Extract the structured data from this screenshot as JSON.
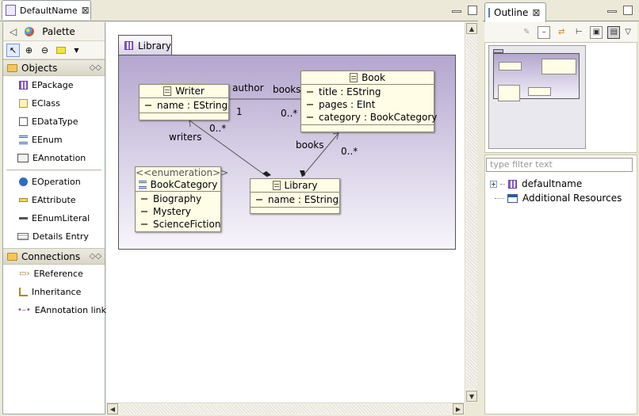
{
  "editor": {
    "tab_title": "DefaultName",
    "close_glyph": "⊠"
  },
  "palette": {
    "title": "Palette",
    "objects_drawer": "Objects",
    "objects": [
      "EPackage",
      "EClass",
      "EDataType",
      "EEnum",
      "EAnnotation"
    ],
    "features": [
      "EOperation",
      "EAttribute",
      "EEnumLiteral",
      "Details Entry"
    ],
    "connections_drawer": "Connections",
    "connections": [
      "EReference",
      "Inheritance",
      "EAnnotation link"
    ],
    "tools": [
      "select-tool",
      "zoom-in-tool",
      "zoom-out-tool",
      "note-tool"
    ]
  },
  "diagram": {
    "package_name": "Library",
    "writer": {
      "name": "Writer",
      "attr": "name : EString"
    },
    "book": {
      "name": "Book",
      "attrs": [
        "title : EString",
        "pages : EInt",
        "category : BookCategory"
      ]
    },
    "library": {
      "name": "Library",
      "attr": "name : EString"
    },
    "enum": {
      "stereotype": "<<enumeration>>",
      "name": "BookCategory",
      "literals": [
        "Biography",
        "Mystery",
        "ScienceFiction"
      ]
    },
    "labels": {
      "author": "author",
      "books_top": "books",
      "one": "1",
      "many_book": "0..*",
      "many_writers": "0..*",
      "writers": "writers",
      "books_lib": "books",
      "many_books_lib": "0..*"
    }
  },
  "outline": {
    "tab_title": "Outline",
    "filter_placeholder": "type filter text",
    "tree": [
      "defaultname",
      "Additional Resources"
    ]
  },
  "colors": {
    "package_top": "#b4a6ce",
    "class_fill": "#fffde6",
    "accent": "#7a96df"
  }
}
